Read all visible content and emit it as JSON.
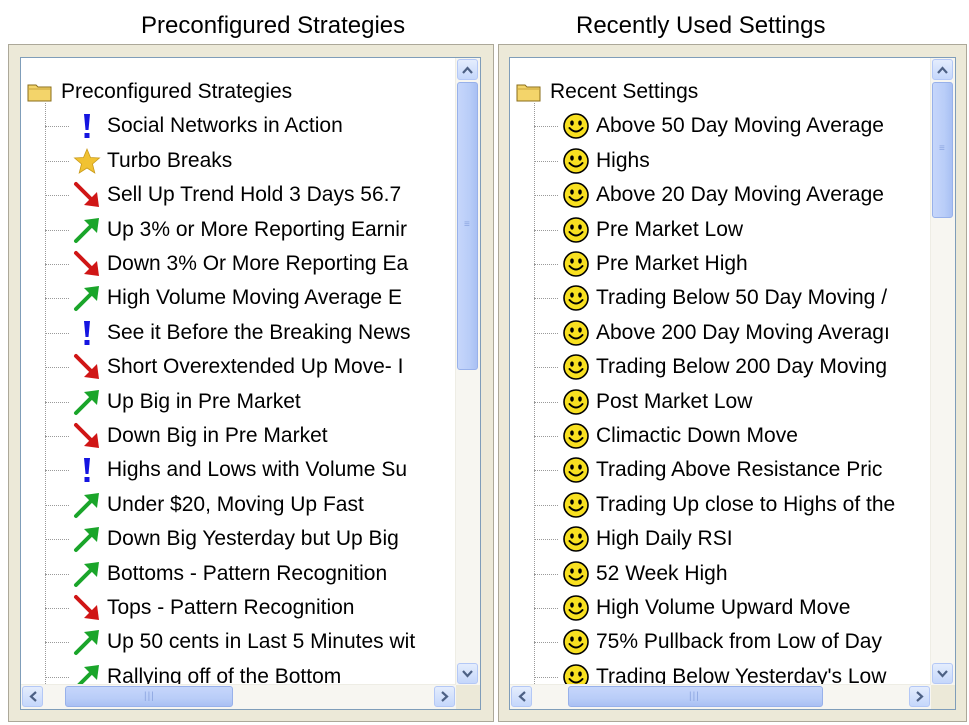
{
  "captions": {
    "left": "Preconfigured Strategies",
    "right": "Recently Used Settings"
  },
  "left_tree": {
    "root_label": "Preconfigured Strategies",
    "items": [
      {
        "label": "Social Networks in Action",
        "icon": "exclamation-icon"
      },
      {
        "label": "Turbo Breaks",
        "icon": "star-icon"
      },
      {
        "label": "Sell Up Trend Hold 3 Days 56.7",
        "icon": "arrow-down-red-icon"
      },
      {
        "label": "Up 3% or More Reporting Earnir",
        "icon": "arrow-up-green-icon"
      },
      {
        "label": "Down 3% Or More Reporting Ea",
        "icon": "arrow-down-red-icon"
      },
      {
        "label": "High Volume Moving Average E",
        "icon": "arrow-up-green-icon"
      },
      {
        "label": "See it Before the Breaking News",
        "icon": "exclamation-icon"
      },
      {
        "label": "Short Overextended Up Move- I",
        "icon": "arrow-down-red-icon"
      },
      {
        "label": "Up Big in Pre Market",
        "icon": "arrow-up-green-icon"
      },
      {
        "label": "Down Big in Pre Market",
        "icon": "arrow-down-red-icon"
      },
      {
        "label": "Highs and Lows with Volume Su",
        "icon": "exclamation-icon"
      },
      {
        "label": "Under $20, Moving Up Fast",
        "icon": "arrow-up-green-icon"
      },
      {
        "label": "Down Big Yesterday but Up Big",
        "icon": "arrow-up-green-icon"
      },
      {
        "label": "Bottoms - Pattern Recognition",
        "icon": "arrow-up-green-icon"
      },
      {
        "label": "Tops - Pattern Recognition",
        "icon": "arrow-down-red-icon"
      },
      {
        "label": "Up 50 cents in Last 5 Minutes wit",
        "icon": "arrow-up-green-icon"
      },
      {
        "label": "Rallying off of the Bottom",
        "icon": "arrow-up-green-icon"
      }
    ]
  },
  "right_tree": {
    "root_label": "Recent Settings",
    "items": [
      {
        "label": "Above 50 Day Moving Average",
        "icon": "smiley-icon"
      },
      {
        "label": "Highs",
        "icon": "smiley-icon"
      },
      {
        "label": "Above 20 Day Moving Average",
        "icon": "smiley-icon"
      },
      {
        "label": "Pre Market Low",
        "icon": "smiley-icon"
      },
      {
        "label": "Pre Market High",
        "icon": "smiley-icon"
      },
      {
        "label": "Trading Below  50 Day Moving /",
        "icon": "smiley-icon"
      },
      {
        "label": "Above 200 Day Moving Averagı",
        "icon": "smiley-icon"
      },
      {
        "label": "Trading Below  200 Day Moving",
        "icon": "smiley-icon"
      },
      {
        "label": "Post Market Low",
        "icon": "smiley-icon"
      },
      {
        "label": "Climactic Down Move",
        "icon": "smiley-icon"
      },
      {
        "label": "Trading Above Resistance Pric",
        "icon": "smiley-icon"
      },
      {
        "label": "Trading Up close to Highs of the",
        "icon": "smiley-icon"
      },
      {
        "label": "High Daily RSI",
        "icon": "smiley-icon"
      },
      {
        "label": "52 Week High",
        "icon": "smiley-icon"
      },
      {
        "label": "High Volume Upward Move",
        "icon": "smiley-icon"
      },
      {
        "label": "75% Pullback from Low of Day",
        "icon": "smiley-icon"
      },
      {
        "label": "Trading Below Yesterday's Low",
        "icon": "smiley-icon"
      }
    ]
  },
  "colors": {
    "folder": "#f3d46a",
    "arrow_up": "#1aa52a",
    "arrow_down": "#d01616",
    "exclamation": "#1515e0",
    "star": "#f1c232",
    "smiley": "#f8e020",
    "scroll_accent": "#4d6185"
  }
}
